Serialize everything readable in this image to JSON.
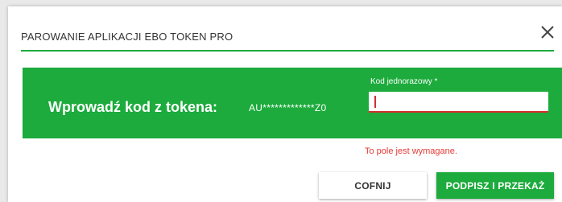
{
  "dialog": {
    "title": "PAROWANIE APLIKACJI EBO TOKEN PRO",
    "close_icon": "close-icon"
  },
  "banner": {
    "prompt": "Wprowadź kod z tokena:",
    "masked_token": "AU*************Z0",
    "field_label": "Kod jednorazowy *",
    "field_value": ""
  },
  "validation": {
    "error_message": "To pole jest wymagane."
  },
  "actions": {
    "cancel_label": "COFNIJ",
    "submit_label": "PODPISZ I PRZEKAŻ"
  },
  "colors": {
    "brand_green": "#1cab3c",
    "error_red": "#d32f2f"
  }
}
